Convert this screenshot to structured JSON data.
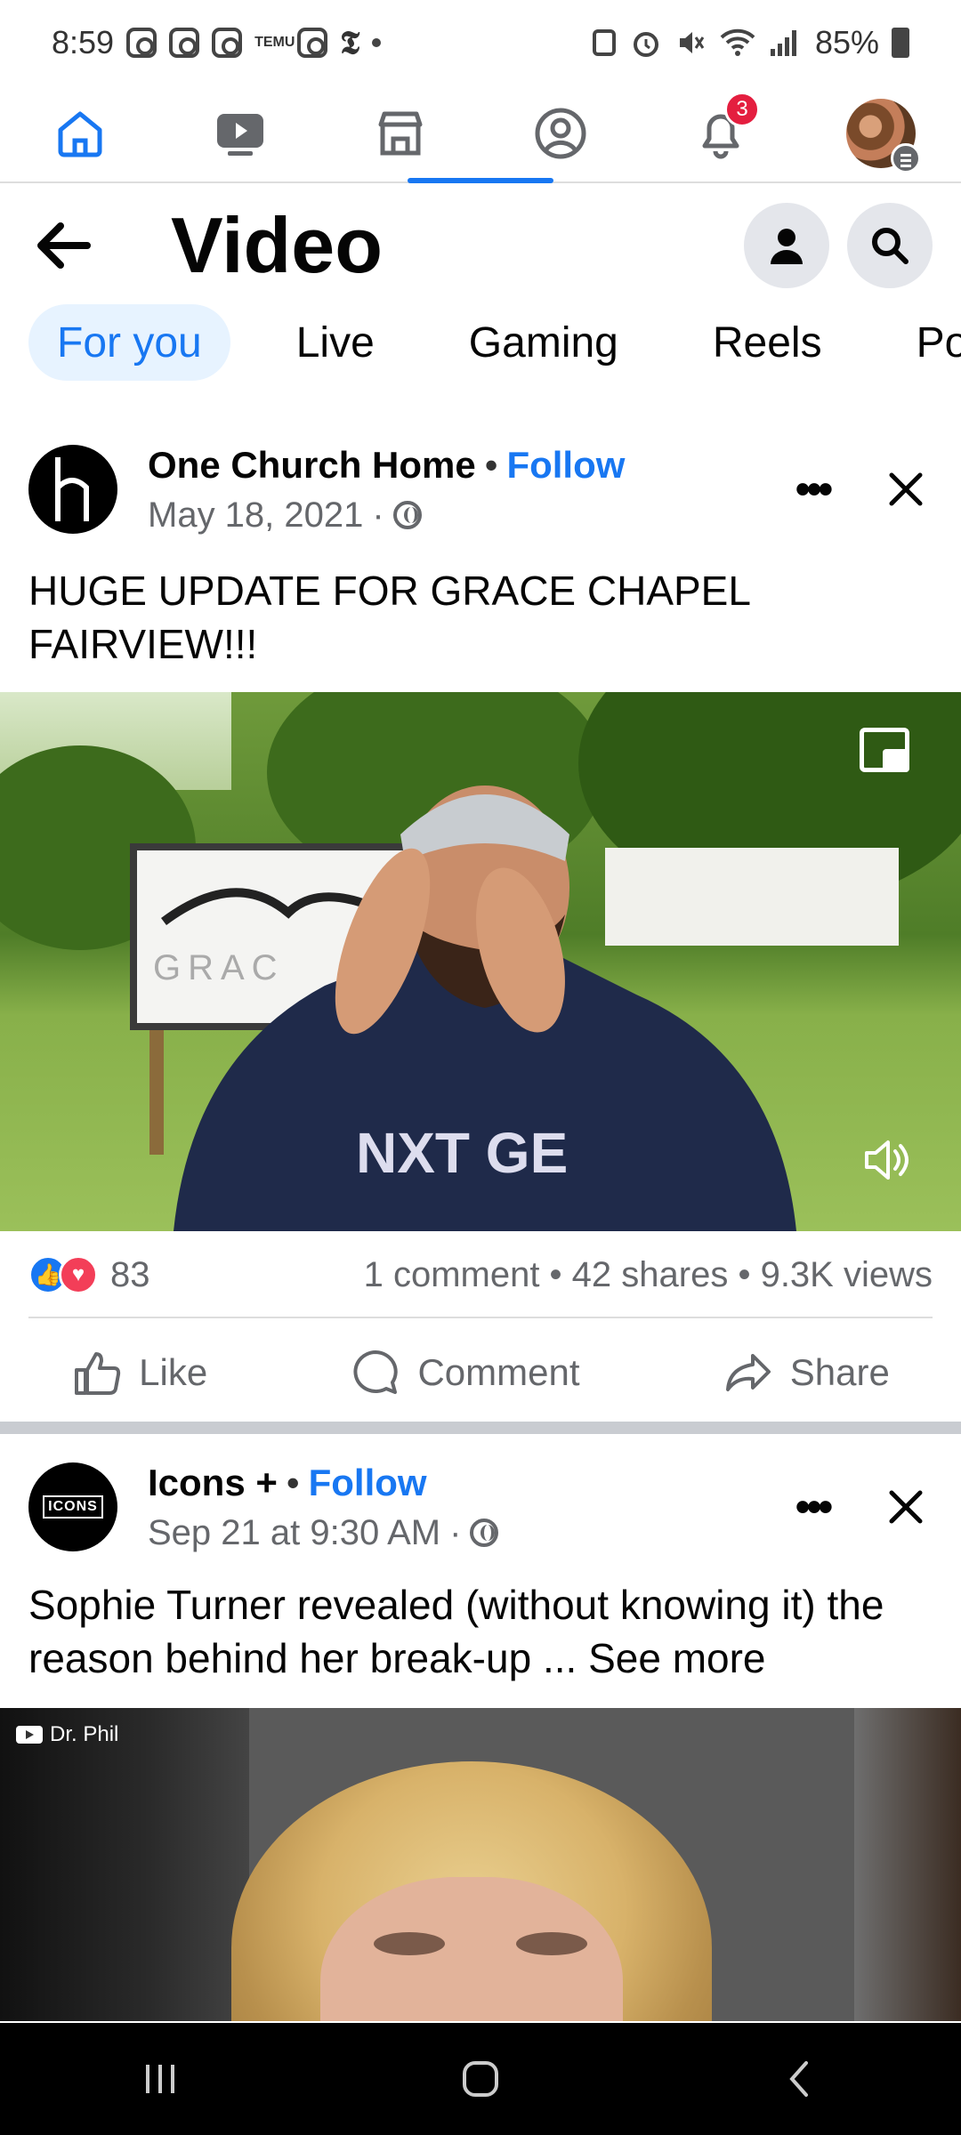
{
  "status_bar": {
    "time": "8:59",
    "app_icons": [
      "instagram-icon",
      "instagram-icon",
      "instagram-icon",
      "temu-icon",
      "instagram-icon",
      "nyt-icon"
    ],
    "temu_text": "TEMU",
    "nyt_text": "𝕿",
    "battery": "85%"
  },
  "top_nav": {
    "items": [
      "home-icon",
      "video-icon",
      "marketplace-icon",
      "profile-icon",
      "notifications-icon",
      "account-menu"
    ],
    "notification_count": "3",
    "active": "video"
  },
  "header": {
    "title": "Video"
  },
  "tabs": [
    "For you",
    "Live",
    "Gaming",
    "Reels",
    "Popu"
  ],
  "posts": [
    {
      "author": "One Church Home",
      "follow_label": "Follow",
      "date": "May 18, 2021",
      "text": "HUGE UPDATE FOR GRACE CHAPEL FAIRVIEW!!!",
      "video_sign_text": "GRAC",
      "reaction_count": "83",
      "stats": "1 comment • 42 shares • 9.3K views",
      "actions": [
        "Like",
        "Comment",
        "Share"
      ]
    },
    {
      "author": "Icons +",
      "follow_label": "Follow",
      "date": "Sep 21 at 9:30 AM",
      "avatar_text": "ICONS",
      "text": "Sophie Turner revealed (without knowing it) the reason behind her break-up ... See more",
      "video_label": "Dr. Phil"
    }
  ],
  "separator": "•",
  "colors": {
    "accent": "#1877f2",
    "badge": "#e41e3f",
    "love": "#f33e58",
    "secondary_text": "#65676b"
  }
}
